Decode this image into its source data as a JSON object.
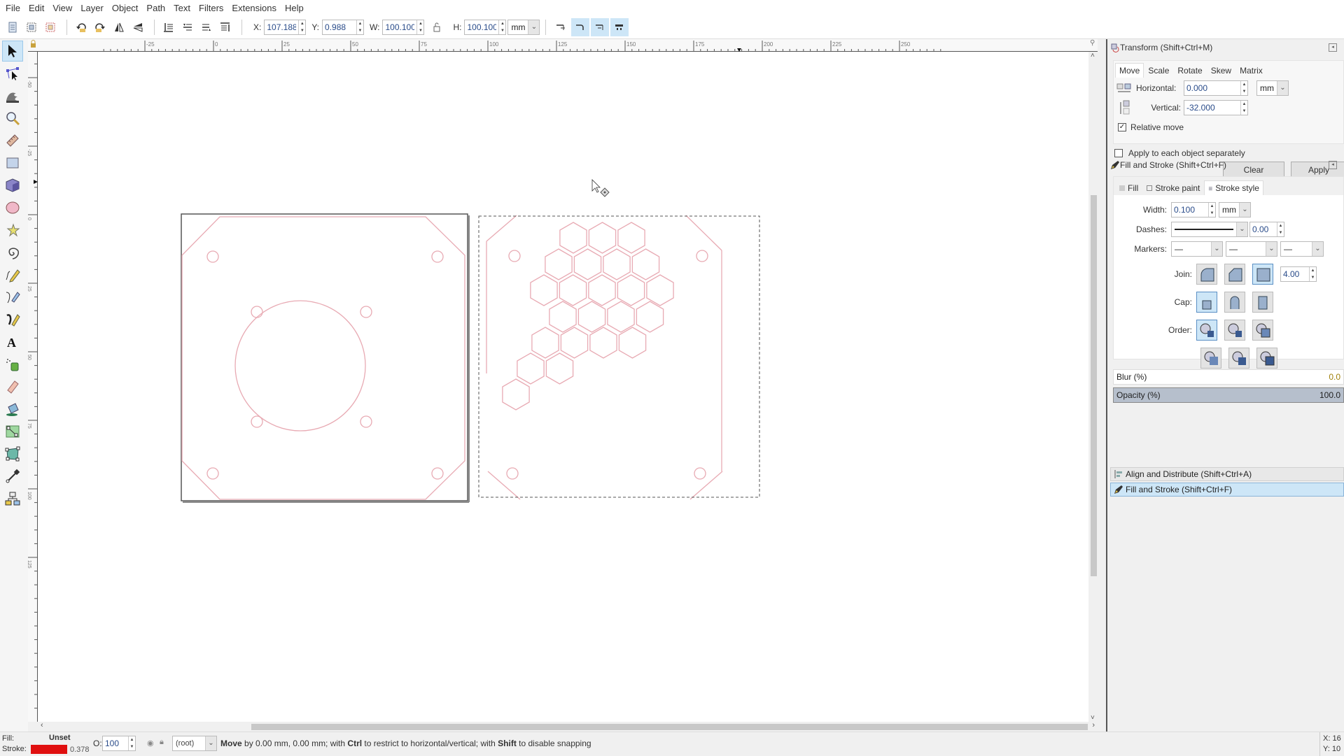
{
  "menubar": {
    "items": [
      "File",
      "Edit",
      "View",
      "Layer",
      "Object",
      "Path",
      "Text",
      "Filters",
      "Extensions",
      "Help"
    ]
  },
  "toolbar": {
    "x_label": "X:",
    "x_value": "107.188",
    "y_label": "Y:",
    "y_value": "0.988",
    "w_label": "W:",
    "w_value": "100.100",
    "h_label": "H:",
    "h_value": "100.100",
    "unit": "mm",
    "icons": [
      "select-all-icon",
      "select-all-layers-icon",
      "deselect-icon",
      "rotate-ccw-icon",
      "rotate-cw-icon",
      "flip-horizontal-icon",
      "flip-vertical-icon",
      "lower-to-bottom-icon",
      "lower-icon",
      "raise-icon",
      "raise-to-top-icon"
    ],
    "transform_toggles": [
      {
        "name": "scale-stroke-toggle",
        "active": false
      },
      {
        "name": "scale-corners-toggle",
        "active": true
      },
      {
        "name": "transform-gradients-toggle",
        "active": true
      },
      {
        "name": "transform-patterns-toggle",
        "active": true
      }
    ]
  },
  "toolbox": {
    "tools": [
      {
        "name": "selector-tool",
        "active": true
      },
      {
        "name": "node-tool",
        "active": false
      },
      {
        "name": "tweak-tool",
        "active": false
      },
      {
        "name": "zoom-tool",
        "active": false
      },
      {
        "name": "measure-tool",
        "active": false
      },
      {
        "name": "rectangle-tool",
        "active": false
      },
      {
        "name": "3d-box-tool",
        "active": false
      },
      {
        "name": "ellipse-tool",
        "active": false
      },
      {
        "name": "star-tool",
        "active": false
      },
      {
        "name": "spiral-tool",
        "active": false
      },
      {
        "name": "pencil-tool",
        "active": false
      },
      {
        "name": "pen-tool",
        "active": false
      },
      {
        "name": "calligraphy-tool",
        "active": false
      },
      {
        "name": "text-tool",
        "active": false
      },
      {
        "name": "spray-tool",
        "active": false
      },
      {
        "name": "eraser-tool",
        "active": false
      },
      {
        "name": "paint-bucket-tool",
        "active": false
      },
      {
        "name": "gradient-tool",
        "active": false
      },
      {
        "name": "mesh-tool",
        "active": false
      },
      {
        "name": "dropper-tool",
        "active": false
      },
      {
        "name": "connector-tool",
        "active": false
      }
    ]
  },
  "rulers": {
    "horizontal_ticks": [
      "-25",
      "0",
      "25",
      "50",
      "75",
      "100",
      "125",
      "150",
      "175",
      "200",
      "225",
      "250"
    ],
    "vertical_ticks": [
      "-50",
      "-25",
      "0",
      "25",
      "50",
      "75",
      "100",
      "125"
    ]
  },
  "canvas": {
    "stroke_color": "#e8aab3",
    "selection_color": "#444444",
    "hex_rows": [
      3,
      4,
      5,
      4,
      4,
      2,
      1
    ]
  },
  "transform_panel": {
    "title": "Transform (Shift+Ctrl+M)",
    "tabs": [
      "Move",
      "Scale",
      "Rotate",
      "Skew",
      "Matrix"
    ],
    "active_tab": "Move",
    "horizontal_label": "Horizontal:",
    "horizontal_value": "0.000",
    "vertical_label": "Vertical:",
    "vertical_value": "-32.000",
    "unit": "mm",
    "relative_move_label": "Relative move",
    "relative_move_checked": true,
    "apply_each_label": "Apply to each object separately",
    "apply_each_checked": false,
    "clear_label": "Clear",
    "apply_label": "Apply"
  },
  "fill_stroke_panel": {
    "title": "Fill and Stroke (Shift+Ctrl+F)",
    "tabs": [
      "Fill",
      "Stroke paint",
      "Stroke style"
    ],
    "active_tab": "Stroke style",
    "width_label": "Width:",
    "width_value": "0.100",
    "width_unit": "mm",
    "dashes_label": "Dashes:",
    "dash_offset": "0.00",
    "markers_label": "Markers:",
    "join_label": "Join:",
    "miter_limit": "4.00",
    "cap_label": "Cap:",
    "order_label": "Order:",
    "blur_label": "Blur (%)",
    "blur_value": "0.0",
    "opacity_label": "Opacity (%)",
    "opacity_value": "100.0"
  },
  "dock_collapsed": {
    "align_label": "Align and Distribute (Shift+Ctrl+A)",
    "fill_label": "Fill and Stroke (Shift+Ctrl+F)"
  },
  "statusbar": {
    "fill_label": "Fill:",
    "fill_value": "Unset",
    "stroke_label": "Stroke:",
    "stroke_color": "#e01010",
    "stroke_width": "0.378",
    "opacity_label": "O:",
    "opacity_value": "100",
    "layer": "(root)",
    "message_bold1": "Move",
    "message_part1": " by 0.00 mm, 0.00 mm; with ",
    "message_bold2": "Ctrl",
    "message_part2": " to restrict to horizontal/vertical; with ",
    "message_bold3": "Shift",
    "message_part3": " to disable snapping",
    "cursor_x_label": "X:",
    "cursor_x_value": "16",
    "cursor_y_label": "Y:",
    "cursor_y_value": "10"
  }
}
